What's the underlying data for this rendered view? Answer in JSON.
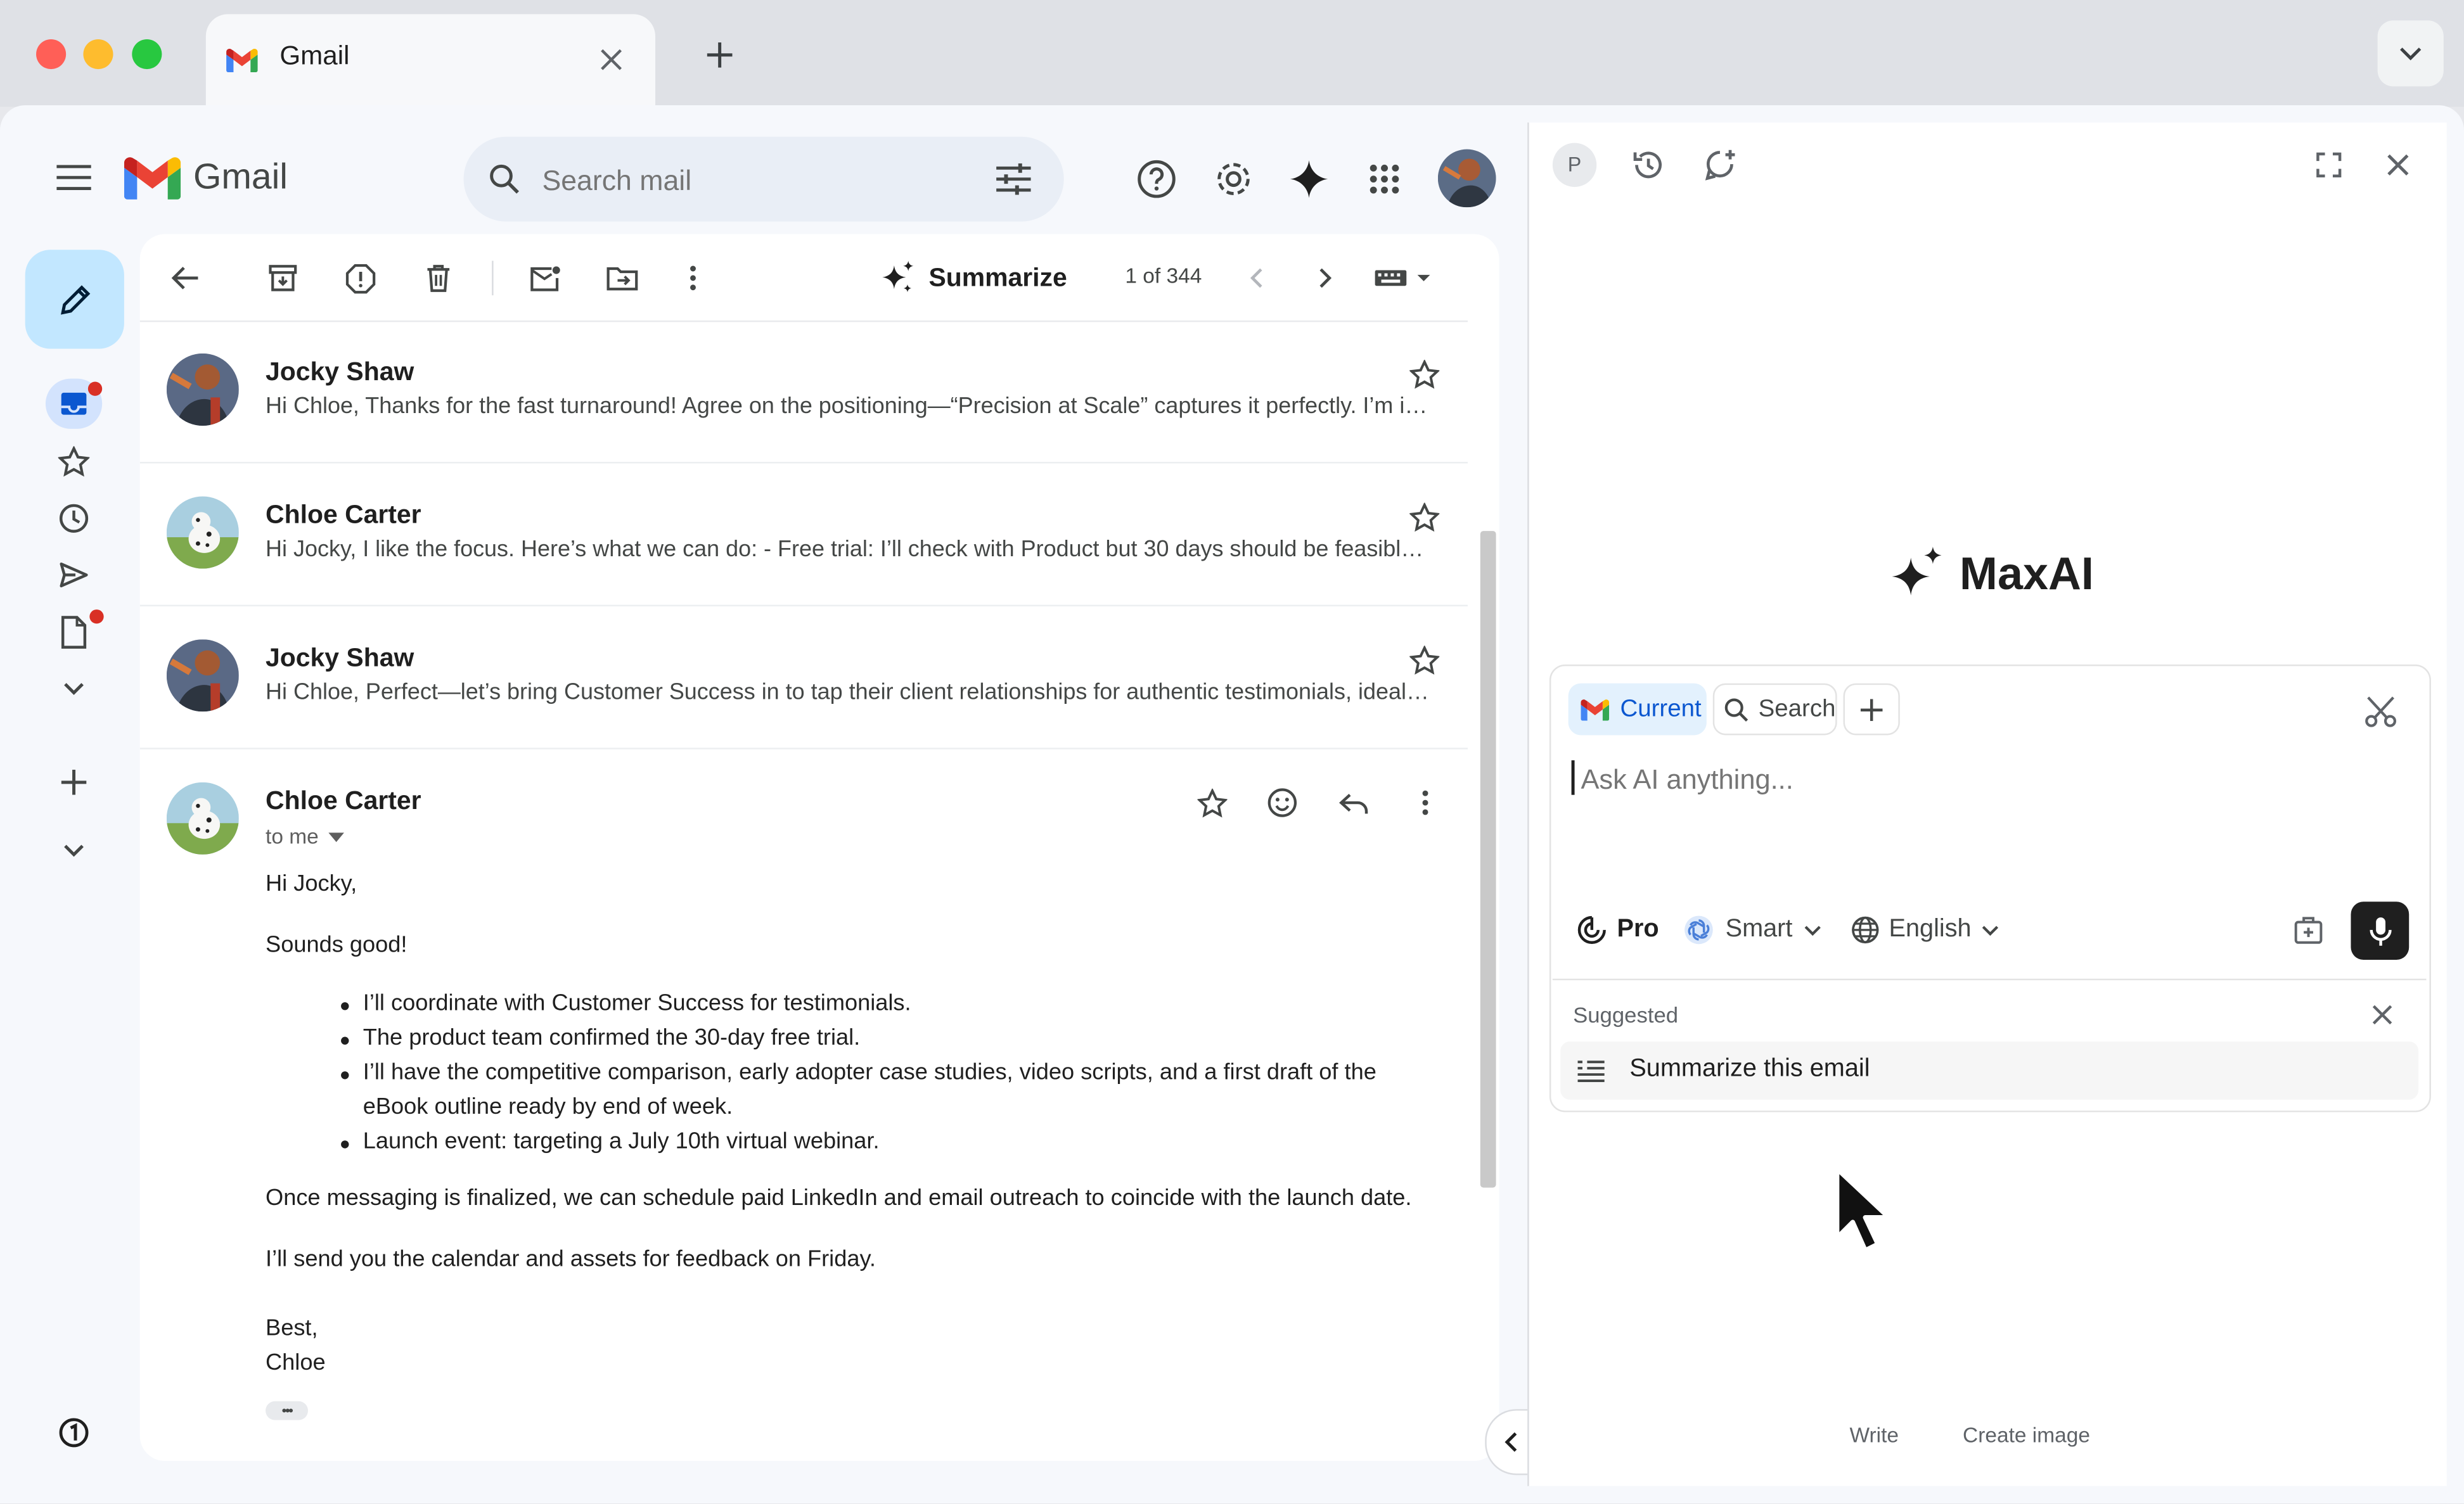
{
  "browser": {
    "tab_title": "Gmail",
    "new_tab_symbol": "+",
    "close_tab_symbol": "✕"
  },
  "gmail": {
    "logo_text": "Gmail",
    "search_placeholder": "Search mail",
    "toolbar": {
      "summarize_label": "Summarize",
      "pagination": "1 of 344"
    },
    "thread": [
      {
        "sender": "Jocky Shaw",
        "snippet": "Hi Chloe, Thanks for the fast turnaround! Agree on the positioning—“Precision at Scale” captures it perfectly. I’m i…"
      },
      {
        "sender": "Chloe Carter",
        "snippet": "Hi Jocky, I like the focus. Here’s what we can do: - Free trial: I’ll check with Product but 30 days should be feasibl…"
      },
      {
        "sender": "Jocky Shaw",
        "snippet": "Hi Chloe, Perfect—let’s bring Customer Success in to tap their client relationships for authentic testimonials, ideal…"
      }
    ],
    "open_message": {
      "sender": "Chloe Carter",
      "to": "to me",
      "greeting": "Hi Jocky,",
      "line1": "Sounds good!",
      "bullets": [
        "I’ll coordinate with Customer Success for testimonials.",
        "The product team confirmed the 30-day free trial.",
        "I’ll have the competitive comparison, early adopter case studies, video scripts, and a first draft of the",
        "eBook outline ready by end of week.",
        "Launch event: targeting a July 10th virtual webinar."
      ],
      "para1": "Once messaging is finalized, we can schedule paid LinkedIn and email outreach to coincide with the launch date.",
      "para2": "I’ll send you the calendar and assets for feedback on Friday.",
      "signoff": "Best,",
      "signature": "Chloe",
      "trimmed": "•••"
    }
  },
  "maxai": {
    "avatar_letter": "P",
    "brand": "MaxAI",
    "chips": {
      "current": "Current",
      "search": "Search"
    },
    "input_placeholder": "Ask AI anything...",
    "options": {
      "pro": "Pro",
      "model": "Smart",
      "language": "English"
    },
    "suggested_label": "Suggested",
    "suggestion": "Summarize this email",
    "bottom_tabs": {
      "write": "Write",
      "create_image": "Create image"
    }
  },
  "colors": {
    "accent_blue": "#0b57d0",
    "compose_bg": "#c2e7ff",
    "chip_current_bg": "#e3f1fd",
    "badge_red": "#d93025",
    "mic_bg": "#1f1f1f"
  }
}
